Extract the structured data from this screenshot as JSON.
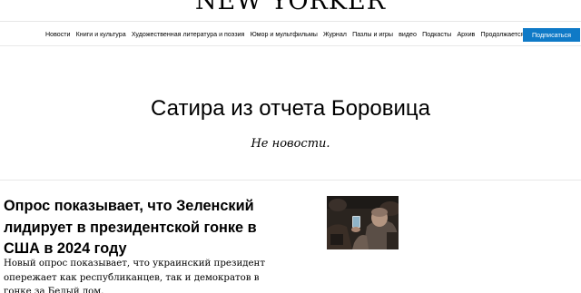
{
  "masthead": {
    "logo_text": "NEW YORKER"
  },
  "nav": {
    "items": [
      "Новости",
      "Книги и культура",
      "Художественная литература и поэзия",
      "Юмор и мультфильмы",
      "Журнал",
      "Пазлы и игры",
      "видео",
      "Подкасты",
      "Архив",
      "Продолжается"
    ],
    "subscribe_label": "Подписаться"
  },
  "page": {
    "title": "Сатира из отчета Боровица",
    "subtitle": "Не новости."
  },
  "article": {
    "headline": "Опрос показывает, что Зеленский лидирует в президентской гонке в США в 2024 году",
    "dek": "Новый опрос показывает, что украинский президент опережает как республиканцев, так и демократов в гонке за Белый дом."
  },
  "colors": {
    "accent": "#0f7ac7"
  }
}
